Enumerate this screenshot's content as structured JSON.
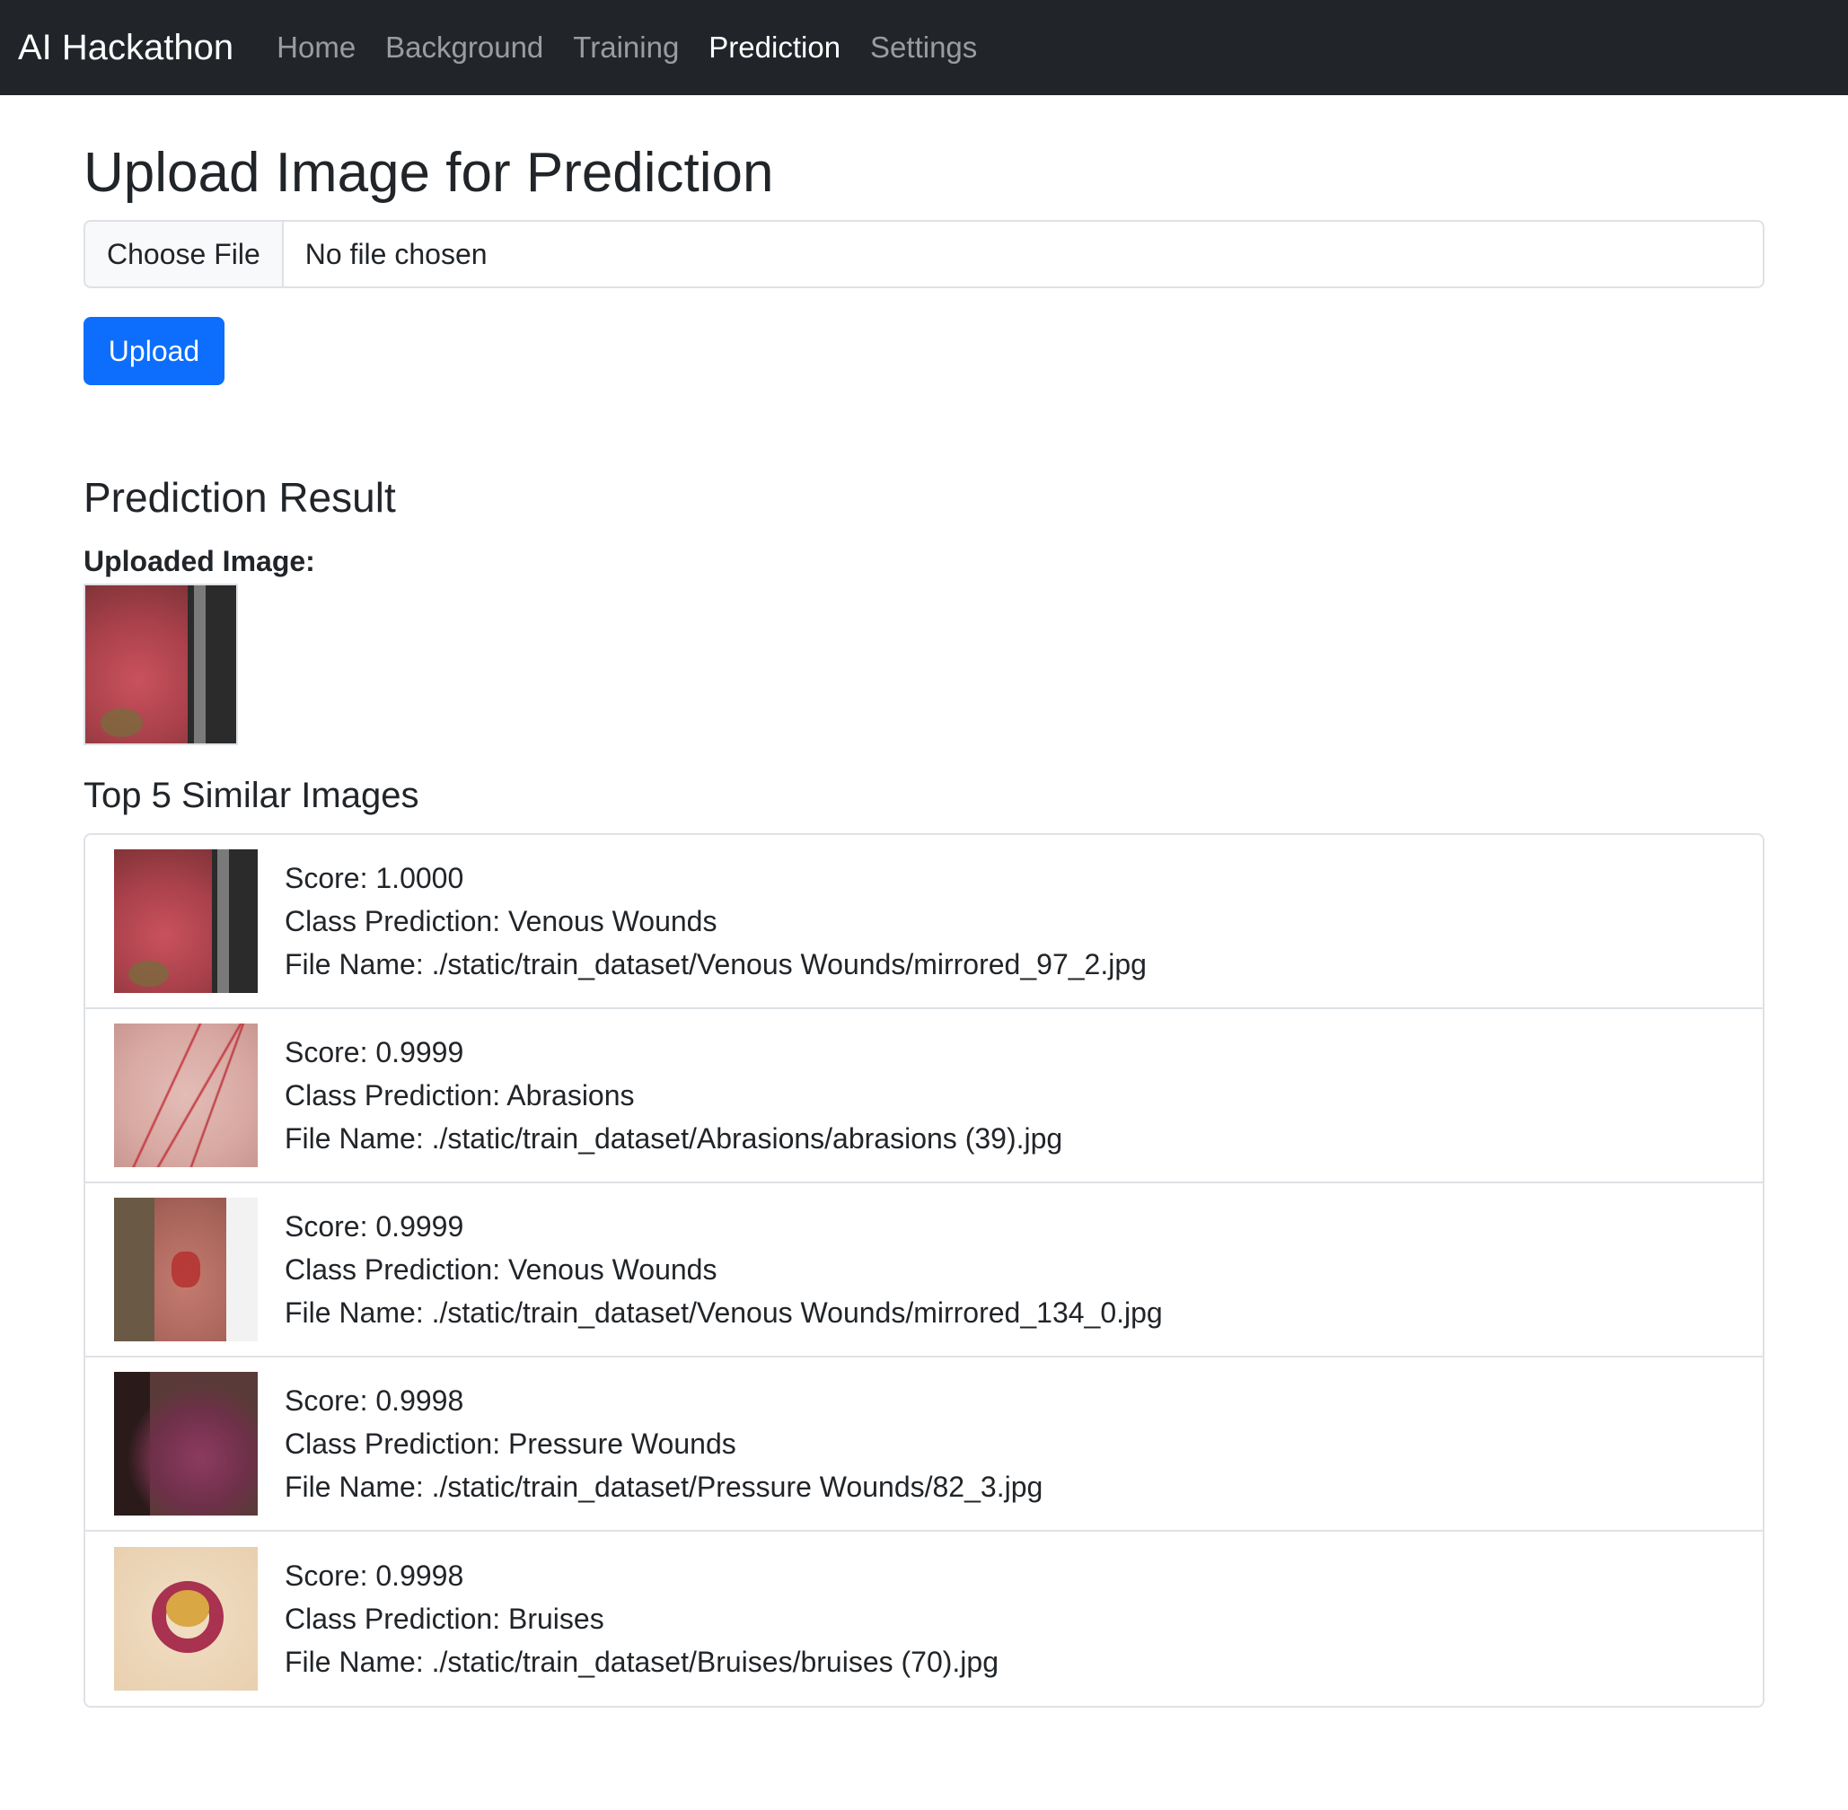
{
  "navbar": {
    "brand": "AI Hackathon",
    "links": [
      {
        "label": "Home",
        "active": false
      },
      {
        "label": "Background",
        "active": false
      },
      {
        "label": "Training",
        "active": false
      },
      {
        "label": "Prediction",
        "active": true
      },
      {
        "label": "Settings",
        "active": false
      }
    ]
  },
  "upload": {
    "title": "Upload Image for Prediction",
    "choose_file_label": "Choose File",
    "file_status": "No file chosen",
    "upload_button": "Upload"
  },
  "result": {
    "title": "Prediction Result",
    "uploaded_label": "Uploaded Image:",
    "similar_title": "Top 5 Similar Images",
    "items": [
      {
        "score": "Score: 1.0000",
        "class": "Class Prediction: Venous Wounds",
        "file": "File Name: ./static/train_dataset/Venous Wounds/mirrored_97_2.jpg"
      },
      {
        "score": "Score: 0.9999",
        "class": "Class Prediction: Abrasions",
        "file": "File Name: ./static/train_dataset/Abrasions/abrasions (39).jpg"
      },
      {
        "score": "Score: 0.9999",
        "class": "Class Prediction: Venous Wounds",
        "file": "File Name: ./static/train_dataset/Venous Wounds/mirrored_134_0.jpg"
      },
      {
        "score": "Score: 0.9998",
        "class": "Class Prediction: Pressure Wounds",
        "file": "File Name: ./static/train_dataset/Pressure Wounds/82_3.jpg"
      },
      {
        "score": "Score: 0.9998",
        "class": "Class Prediction: Bruises",
        "file": "File Name: ./static/train_dataset/Bruises/bruises (70).jpg"
      }
    ]
  },
  "colors": {
    "navbar_bg": "#212529",
    "primary": "#0d6efd",
    "border": "#dee2e6"
  }
}
